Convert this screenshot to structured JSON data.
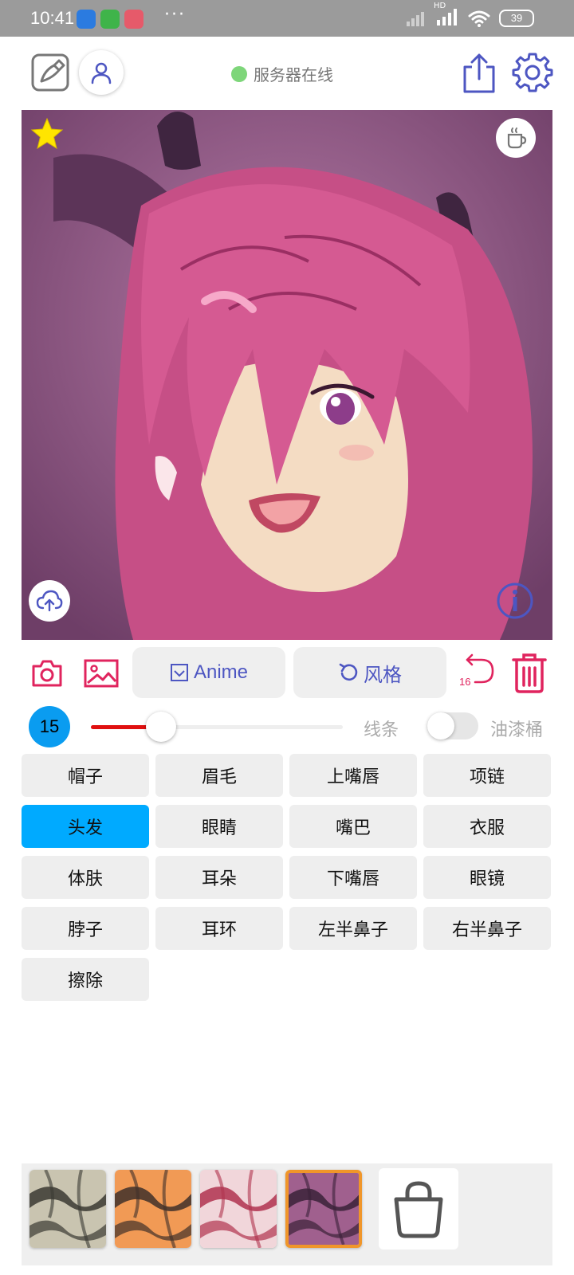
{
  "status_bar": {
    "time": "10:41",
    "more": "···",
    "network": "HD",
    "battery": "39"
  },
  "header": {
    "server_status": "服务器在线"
  },
  "toolbar": {
    "anime_label": "Anime",
    "style_label": "风格",
    "undo_count": "16"
  },
  "slider": {
    "value": "15",
    "fraction": 0.28,
    "line_label": "线条",
    "bucket_label": "油漆桶"
  },
  "parts": [
    {
      "label": "帽子",
      "active": false
    },
    {
      "label": "眉毛",
      "active": false
    },
    {
      "label": "上嘴唇",
      "active": false
    },
    {
      "label": "项链",
      "active": false
    },
    {
      "label": "头发",
      "active": true
    },
    {
      "label": "眼睛",
      "active": false
    },
    {
      "label": "嘴巴",
      "active": false
    },
    {
      "label": "衣服",
      "active": false
    },
    {
      "label": "体肤",
      "active": false
    },
    {
      "label": "耳朵",
      "active": false
    },
    {
      "label": "下嘴唇",
      "active": false
    },
    {
      "label": "眼镜",
      "active": false
    },
    {
      "label": "脖子",
      "active": false
    },
    {
      "label": "耳环",
      "active": false
    },
    {
      "label": "左半鼻子",
      "active": false
    },
    {
      "label": "右半鼻子",
      "active": false
    },
    {
      "label": "擦除",
      "active": false
    }
  ],
  "styles": [
    {
      "name": "style-1",
      "colors": [
        "#c9c4b0",
        "#3b3a33"
      ],
      "selected": false
    },
    {
      "name": "style-2",
      "colors": [
        "#f19a55",
        "#40302a"
      ],
      "selected": false
    },
    {
      "name": "style-3",
      "colors": [
        "#f1d6da",
        "#b0334f"
      ],
      "selected": false
    },
    {
      "name": "style-4",
      "colors": [
        "#a0608e",
        "#3a2238"
      ],
      "selected": true
    }
  ],
  "colors": {
    "accent": "#4d56c2",
    "danger": "#e0245e",
    "active_chip": "#00aaff",
    "server_online": "#7ed67a",
    "slider_fill": "#e01010"
  }
}
